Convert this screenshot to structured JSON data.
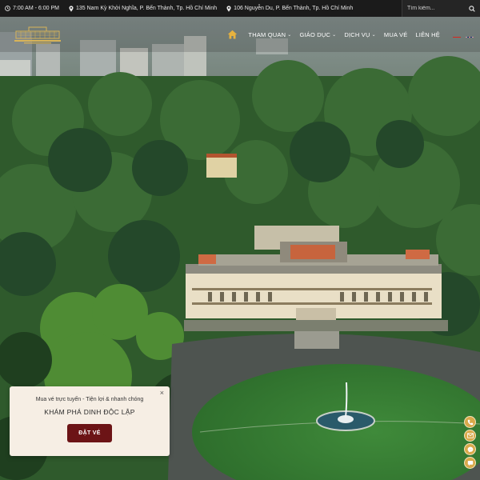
{
  "topbar": {
    "hours": "7:00 AM - 6:00 PM",
    "address_1": "135 Nam Kỳ Khởi Nghĩa, P. Bến Thành, Tp. Hồ Chí Minh",
    "address_2": "106 Nguyễn Du, P. Bến Thành, Tp. Hồ Chí Minh",
    "search_placeholder": "Tìm kiếm..."
  },
  "nav": {
    "items": [
      {
        "label": "THAM QUAN",
        "has_dropdown": true
      },
      {
        "label": "GIÁO DỤC",
        "has_dropdown": true
      },
      {
        "label": "DỊCH VỤ",
        "has_dropdown": true
      },
      {
        "label": "MUA VÉ",
        "has_dropdown": false
      },
      {
        "label": "LIÊN HỆ",
        "has_dropdown": false
      }
    ],
    "chevron": "⌄"
  },
  "promo": {
    "subtitle": "Mua vé trực tuyến - Tiện lợi & nhanh chóng",
    "title": "KHÁM PHÁ DINH ĐỘC LẬP",
    "button_label": "ĐẶT VÉ",
    "close_glyph": "×"
  },
  "colors": {
    "topbar_bg": "#1b1b1b",
    "accent_gold": "#d9a94a",
    "button_red": "#6c1416",
    "popup_bg": "#f6eee4"
  },
  "icons": [
    "clock-icon",
    "location-pin-icon",
    "search-icon",
    "home-icon",
    "vietnam-flag-icon",
    "uk-flag-icon",
    "phone-icon",
    "email-icon",
    "messenger-icon",
    "chat-icon"
  ]
}
